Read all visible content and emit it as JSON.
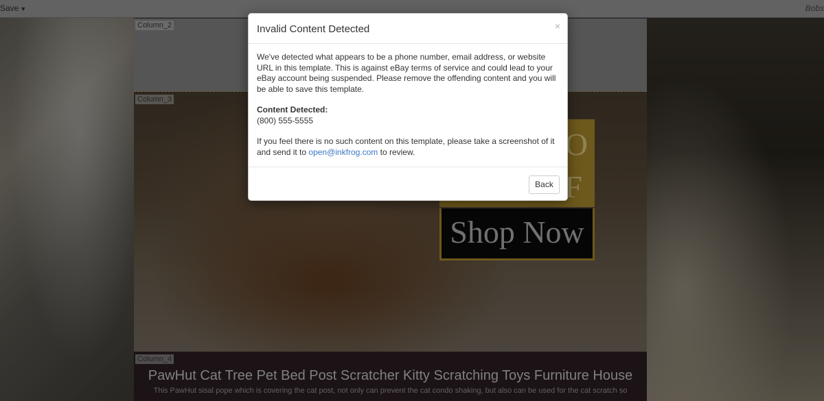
{
  "topbar": {
    "save_label": "Save",
    "user_label": "Bobs"
  },
  "columns": {
    "column2_label": "Column_2",
    "column3_label": "Column_3",
    "column4_label": "Column_4"
  },
  "banner": {
    "gold_line1": "O",
    "gold_line2": "F",
    "shop_button": "Shop Now"
  },
  "product": {
    "title": "PawHut Cat Tree Pet Bed Post Scratcher Kitty Scratching Toys Furniture House",
    "description": "This PawHut sisal pope which is covering the cat post, not only can prevent the cat condo shaking, but also can be used for the cat scratch so"
  },
  "modal": {
    "title": "Invalid Content Detected",
    "close_glyph": "×",
    "message": "We've detected what appears to be a phone number, email address, or website URL in this template. This is against eBay terms of service and could lead to your eBay account being suspended. Please remove the offending content and you will be able to save this template.",
    "detected_heading": "Content Detected:",
    "detected_value": "(800) 555-5555",
    "review_text_before": "If you feel there is no such content on this template, please take a screenshot of it and send it to ",
    "review_link": "open@inkfrog.com",
    "review_text_after": " to review.",
    "back_button": "Back"
  },
  "colors": {
    "accent_gold": "#b1902e",
    "link_blue": "#3a78c4"
  }
}
